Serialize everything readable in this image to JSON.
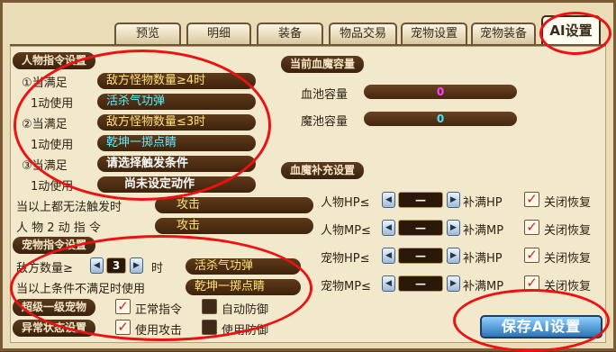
{
  "tabs": [
    "预览",
    "明细",
    "装备",
    "物品交易",
    "宠物设置",
    "宠物装备",
    "AI设置"
  ],
  "active_tab": "AI设置",
  "char_section": {
    "title": "人物指令设置",
    "rows": [
      {
        "cond_label": "①当满足",
        "cond": "敌方怪物数量≥4时",
        "use_label": "1动使用",
        "skill": "活杀气功弹"
      },
      {
        "cond_label": "②当满足",
        "cond": "敌方怪物数量≤3时",
        "use_label": "1动使用",
        "skill": "乾坤一掷点睛"
      },
      {
        "cond_label": "③当满足",
        "cond": "请选择触发条件",
        "use_label": "1动使用",
        "skill": "尚未设定动作"
      }
    ],
    "fallback1_label": "当以上都无法触发时",
    "fallback1_value": "攻击",
    "fallback2_label": "人 物 2 动 指 令",
    "fallback2_value": "攻击"
  },
  "pet_section": {
    "title": "宠物指令设置",
    "enemy_count_label": "敌方数量≥",
    "enemy_count_value": "3",
    "enemy_count_suffix": "时",
    "enemy_skill": "活杀气功弹",
    "fallback_label": "当以上条件不满足时使用",
    "fallback_skill": "乾坤一掷点睛",
    "row1_label": "超级一级宠物",
    "row1_opt1": "正常指令",
    "row1_opt2": "自动防御",
    "row2_label": "异常状态设置",
    "row2_opt1": "使用攻击",
    "row2_opt2": "使用防御"
  },
  "capacity_section": {
    "title": "当前血魔容量",
    "hp_label": "血池容量",
    "hp_value": "0",
    "mp_label": "魔池容量",
    "mp_value": "0"
  },
  "refill_section": {
    "title": "血魔补充设置",
    "rows": [
      {
        "label": "人物HP≤",
        "value": "—",
        "suffix": "补满HP",
        "close": "关闭恢复"
      },
      {
        "label": "人物MP≤",
        "value": "—",
        "suffix": "补满MP",
        "close": "关闭恢复"
      },
      {
        "label": "宠物HP≤",
        "value": "—",
        "suffix": "补满HP",
        "close": "关闭恢复"
      },
      {
        "label": "宠物MP≤",
        "value": "—",
        "suffix": "补满MP",
        "close": "关闭恢复"
      }
    ]
  },
  "save_button": "保存AI设置",
  "colors": {
    "hp_value": "#ff40ff",
    "mp_value": "#40e8ff",
    "accent_ring": "#ee1111"
  }
}
